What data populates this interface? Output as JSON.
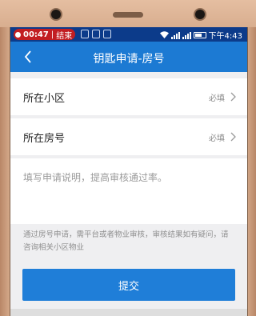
{
  "status_bar": {
    "time": "00:47",
    "end_call": "结束",
    "clock": "下午4:43"
  },
  "header": {
    "title": "钥匙申请-房号",
    "back_icon": "chevron-left-icon"
  },
  "form": {
    "community": {
      "label": "所在小区",
      "required": "必填"
    },
    "room": {
      "label": "所在房号",
      "required": "必填"
    },
    "description_placeholder": "填写申请说明，提高审核通过率。",
    "notice": "通过房号申请，需平台或者物业审核，审核结果如有疑问，请咨询相关小区物业"
  },
  "submit_label": "提交",
  "colors": {
    "status_bar": "#0c3b8a",
    "header": "#1c7ad3",
    "submit": "#1f7ed8",
    "recording_pill": "#c21e22"
  }
}
